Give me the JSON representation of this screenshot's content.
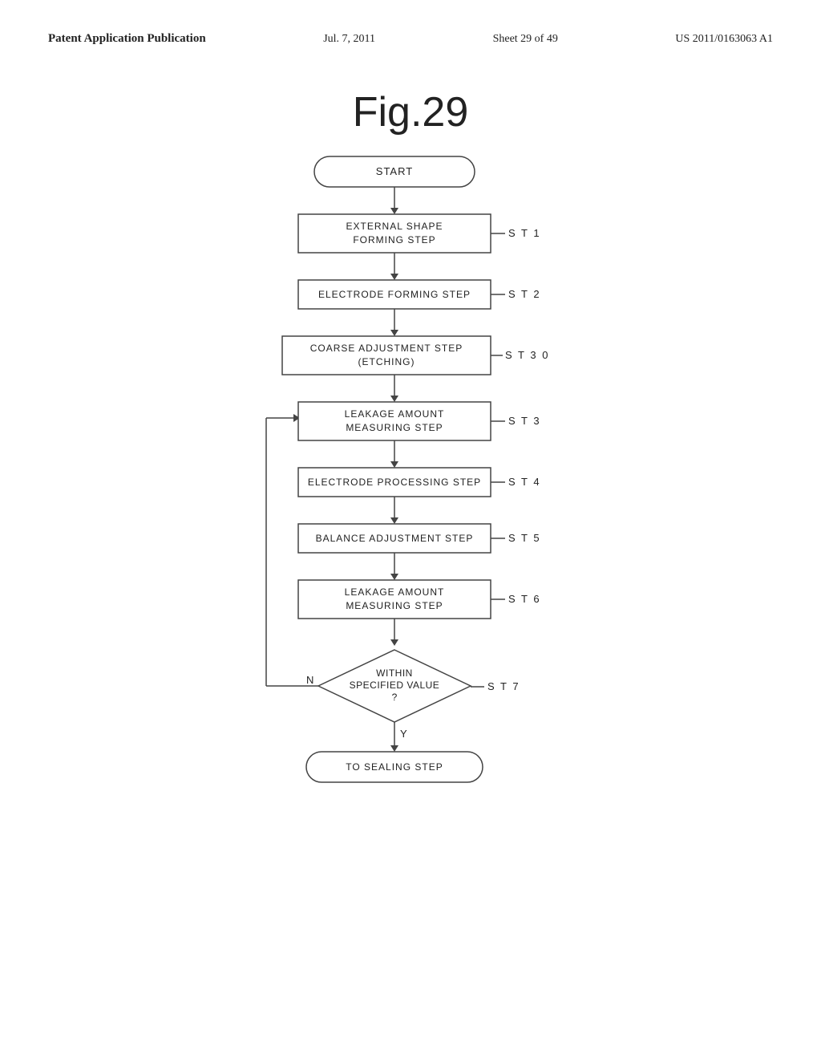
{
  "header": {
    "left": "Patent Application Publication",
    "center": "Jul. 7, 2011",
    "sheet": "Sheet 29 of 49",
    "patent": "US 2011/0163063 A1"
  },
  "figure": {
    "title": "Fig.29"
  },
  "flowchart": {
    "start": "START",
    "steps": [
      {
        "id": "st1",
        "label": "EXTERNAL  SHAPE\nFORMING  STEP",
        "step_label": "S T 1"
      },
      {
        "id": "st2",
        "label": "ELECTRODE  FORMING  STEP",
        "step_label": "S T 2"
      },
      {
        "id": "st30",
        "label": "COARSE  ADJUSTMENT  STEP\n(ETCHING)",
        "step_label": "S T 3 0"
      },
      {
        "id": "st3",
        "label": "LEAKAGE  AMOUNT\nMEASURING  STEP",
        "step_label": "S T 3"
      },
      {
        "id": "st4",
        "label": "ELECTRODE  PROCESSING  STEP",
        "step_label": "S T 4"
      },
      {
        "id": "st5",
        "label": "BALANCE  ADJUSTMENT  STEP",
        "step_label": "S T 5"
      },
      {
        "id": "st6",
        "label": "LEAKAGE  AMOUNT\nMEASURING  STEP",
        "step_label": "S T 6"
      },
      {
        "id": "st7",
        "label": "WITHIN\nSPECIFIED  VALUE\n?",
        "step_label": "S T 7",
        "type": "decision",
        "n_label": "N",
        "y_label": "Y"
      }
    ],
    "end": "TO  SEALING  STEP"
  }
}
